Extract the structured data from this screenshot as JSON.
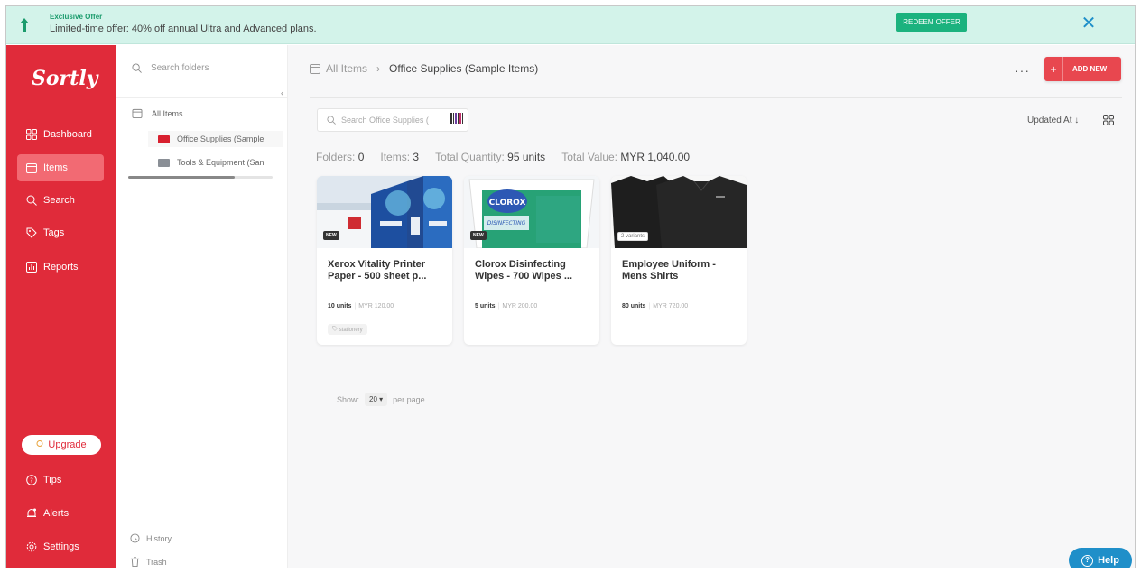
{
  "banner": {
    "title": "Exclusive Offer",
    "message": "Limited-time offer: 40% off annual Ultra and Advanced plans.",
    "redeem_label": "REDEEM OFFER",
    "close_icon": "close-icon"
  },
  "sidebar": {
    "logo": "Sortly",
    "items": [
      {
        "label": "Dashboard",
        "icon": "dashboard-icon"
      },
      {
        "label": "Items",
        "icon": "items-icon"
      },
      {
        "label": "Search",
        "icon": "search-icon"
      },
      {
        "label": "Tags",
        "icon": "tag-icon"
      },
      {
        "label": "Reports",
        "icon": "reports-icon"
      }
    ],
    "upgrade_label": "Upgrade",
    "bottom": [
      {
        "label": "Tips",
        "icon": "tips-icon"
      },
      {
        "label": "Alerts",
        "icon": "bell-icon"
      },
      {
        "label": "Settings",
        "icon": "gear-icon"
      }
    ]
  },
  "folders": {
    "search_placeholder": "Search folders",
    "root": "All Items",
    "children": [
      {
        "label": "Office Supplies (Sample",
        "color": "#d8202f"
      },
      {
        "label": "Tools & Equipment (San",
        "color": "#8a8f96"
      }
    ],
    "history_label": "History",
    "trash_label": "Trash"
  },
  "main": {
    "breadcrumb_root": "All Items",
    "breadcrumb_sep": "›",
    "breadcrumb_current": "Office Supplies (Sample Items)",
    "more_label": "···",
    "add_new_label": "ADD NEW",
    "search_placeholder": "Search Office Supplies (",
    "sort_label": "Updated At ↓",
    "summary": {
      "folders_label": "Folders:",
      "folders_value": "0",
      "items_label": "Items:",
      "items_value": "3",
      "qty_label": "Total Quantity:",
      "qty_value": "95 units",
      "value_label": "Total Value:",
      "value_value": "MYR 1,040.00"
    },
    "cards": [
      {
        "name": "Xerox Vitality Printer Paper - 500 sheet p...",
        "units": "10 units",
        "price": "MYR 120.00",
        "badge": "NEW",
        "tag": "stationery"
      },
      {
        "name": "Clorox Disinfecting Wipes - 700 Wipes ...",
        "units": "5 units",
        "price": "MYR 200.00",
        "badge": "NEW",
        "tag": ""
      },
      {
        "name": "Employee Uniform - Mens Shirts",
        "units": "80 units",
        "price": "MYR 720.00",
        "badge": "2 variants",
        "tag": ""
      }
    ],
    "pager": {
      "show_label": "Show:",
      "per_page_value": "20 ▾",
      "per_page_label": "per page"
    },
    "help_label": "Help"
  },
  "colors": {
    "brand_red": "#e02b3a",
    "banner_bg": "#d3f3ea",
    "redeem_green": "#1bb27e",
    "help_blue": "#1f8fc9"
  }
}
